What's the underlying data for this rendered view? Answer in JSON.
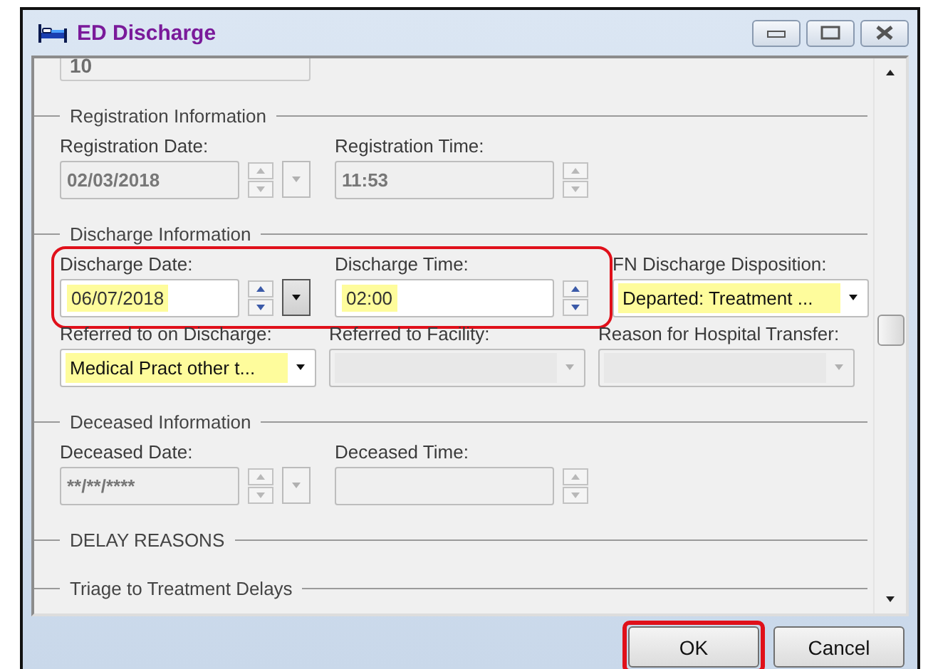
{
  "window": {
    "title": "ED Discharge"
  },
  "top_field": {
    "value": "10",
    "disabled": true
  },
  "sections": [
    {
      "title": "Registration Information",
      "rows": [
        [
          {
            "kind": "date",
            "label": "Registration Date:",
            "value": "02/03/2018",
            "disabled": true,
            "mandatory": false,
            "highlighted": false
          },
          {
            "kind": "time",
            "label": "Registration Time:",
            "value": "11:53",
            "disabled": true,
            "mandatory": false,
            "highlighted": false
          }
        ]
      ]
    },
    {
      "title": "Discharge Information",
      "rows": [
        [
          {
            "kind": "date",
            "label": "Discharge Date:",
            "value": "06/07/2018",
            "disabled": false,
            "mandatory": true,
            "highlighted": true
          },
          {
            "kind": "time",
            "label": "Discharge Time:",
            "value": "02:00",
            "disabled": false,
            "mandatory": true,
            "highlighted": true
          },
          {
            "kind": "combo",
            "label": "FN Discharge Disposition:",
            "value": "Departed: Treatment ...",
            "disabled": false,
            "mandatory": true,
            "highlighted": false
          }
        ],
        [
          {
            "kind": "combo",
            "label": "Referred to on Discharge:",
            "value": "Medical Pract other t...",
            "disabled": false,
            "mandatory": true,
            "highlighted": false
          },
          {
            "kind": "combo",
            "label": "Referred to Facility:",
            "disabled": true,
            "mandatory": false,
            "highlighted": false
          },
          {
            "kind": "combo",
            "label": "Reason for Hospital Transfer:",
            "disabled": true,
            "mandatory": false,
            "highlighted": false
          }
        ]
      ]
    },
    {
      "title": "Deceased Information",
      "rows": [
        [
          {
            "kind": "date",
            "label": "Deceased Date:",
            "value": "**/**/****",
            "disabled": true,
            "mandatory": false,
            "highlighted": false
          },
          {
            "kind": "time",
            "label": "Deceased Time:",
            "disabled": true,
            "mandatory": false,
            "highlighted": false
          }
        ]
      ]
    },
    {
      "title": "DELAY REASONS"
    },
    {
      "title": "Triage to Treatment Delays"
    }
  ],
  "buttons": [
    {
      "label": "OK",
      "highlighted": true
    },
    {
      "label": "Cancel",
      "highlighted": false
    }
  ]
}
